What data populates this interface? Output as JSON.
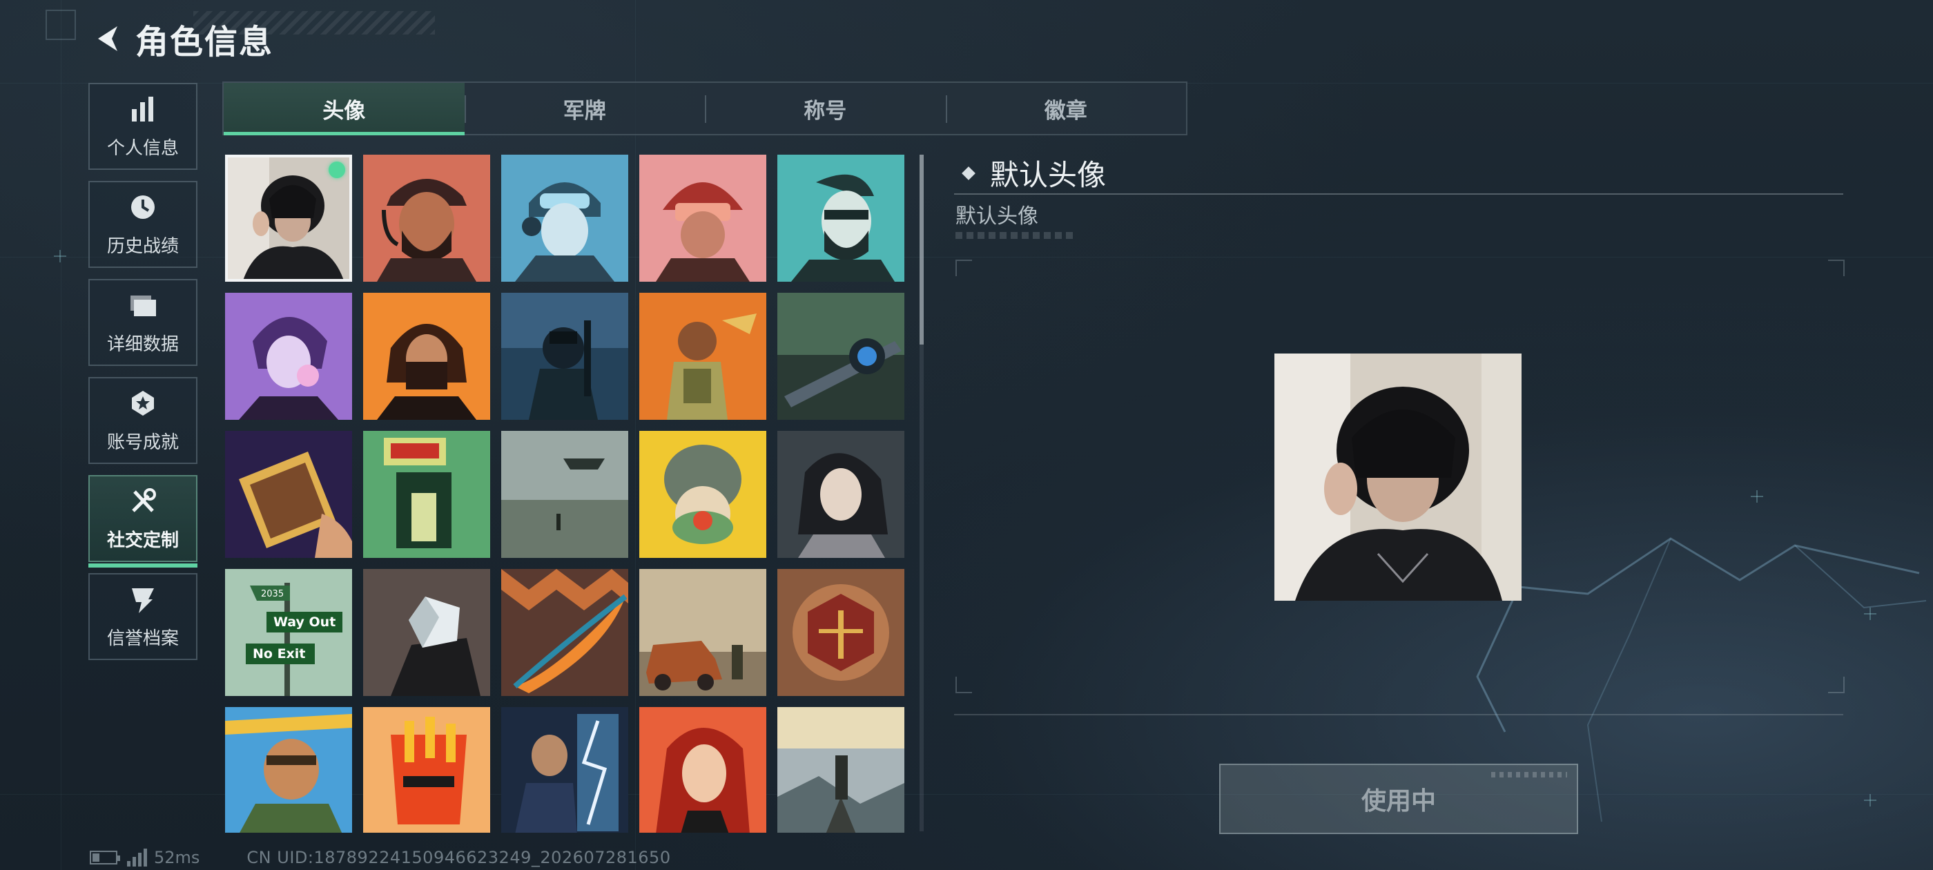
{
  "header": {
    "title": "角色信息"
  },
  "sidebar": {
    "items": [
      {
        "label": "个人信息",
        "icon": "bar-chart-icon"
      },
      {
        "label": "历史战绩",
        "icon": "history-clock-icon"
      },
      {
        "label": "详细数据",
        "icon": "folder-icon"
      },
      {
        "label": "账号成就",
        "icon": "achievement-badge-icon"
      },
      {
        "label": "社交定制",
        "icon": "tools-icon",
        "active": true
      },
      {
        "label": "信誉档案",
        "icon": "shield-bolt-icon"
      }
    ]
  },
  "tabs": [
    {
      "label": "头像",
      "active": true
    },
    {
      "label": "军牌"
    },
    {
      "label": "称号"
    },
    {
      "label": "徽章"
    }
  ],
  "avatars": {
    "selected_index": 0,
    "colors": {
      "selected_dot": "#52d79c",
      "accent": "#5fd3a3"
    },
    "items": [
      {
        "subject": "photo-hoodie-person"
      },
      {
        "subject": "bearded-man-cap-red"
      },
      {
        "subject": "female-pilot-blue"
      },
      {
        "subject": "helmet-soldier-pink"
      },
      {
        "subject": "bearded-man-teal"
      },
      {
        "subject": "woman-bubblegum-purple"
      },
      {
        "subject": "masked-man-orange"
      },
      {
        "subject": "night-vision-soldier"
      },
      {
        "subject": "cartoon-soldier-orange"
      },
      {
        "subject": "sniper-scope"
      },
      {
        "subject": "comic-book-hand"
      },
      {
        "subject": "exit-door-green"
      },
      {
        "subject": "helicopter-battlefield"
      },
      {
        "subject": "cartoon-helmet-noodles"
      },
      {
        "subject": "anime-girl-goggles"
      },
      {
        "subject": "street-sign",
        "signs": [
          "2035",
          "Way Out",
          "No Exit"
        ]
      },
      {
        "subject": "fist-crystal"
      },
      {
        "subject": "orange-feather"
      },
      {
        "subject": "rusty-truck-soldier"
      },
      {
        "subject": "bronze-scales-emblem"
      },
      {
        "subject": "bearded-man-festive"
      },
      {
        "subject": "cartoon-fries-creature"
      },
      {
        "subject": "scientist-lightning"
      },
      {
        "subject": "red-haired-woman"
      },
      {
        "subject": "soldier-mountain-peak"
      }
    ]
  },
  "detail": {
    "name": "默认头像",
    "description": "默认头像",
    "button_label": "使用中"
  },
  "status": {
    "ping": "52ms",
    "uid": "CN UID:18789224150946623249_202607281650"
  }
}
